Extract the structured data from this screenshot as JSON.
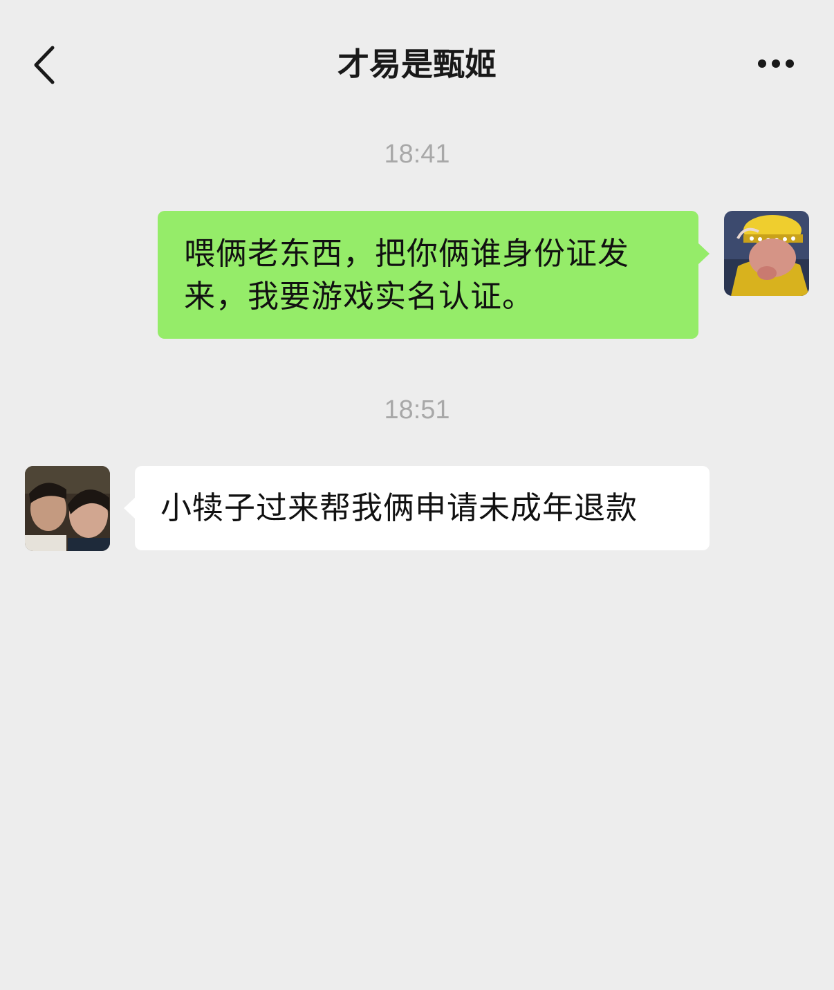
{
  "header": {
    "title": "才易是甄姬",
    "back_icon": "chevron-left-icon",
    "more_icon": "more-dots-icon"
  },
  "messages": [
    {
      "timestamp": "18:41",
      "direction": "sent",
      "text": "喂俩老东西，把你俩谁身份证发来，我要游戏实名认证。",
      "bubble_color": "#95ec69"
    },
    {
      "timestamp": "18:51",
      "direction": "received",
      "text": "小犊子过来帮我俩申请未成年退款",
      "bubble_color": "#ffffff"
    }
  ],
  "colors": {
    "background": "#ededed",
    "timestamp": "#a8a8a8",
    "text": "#111111"
  }
}
